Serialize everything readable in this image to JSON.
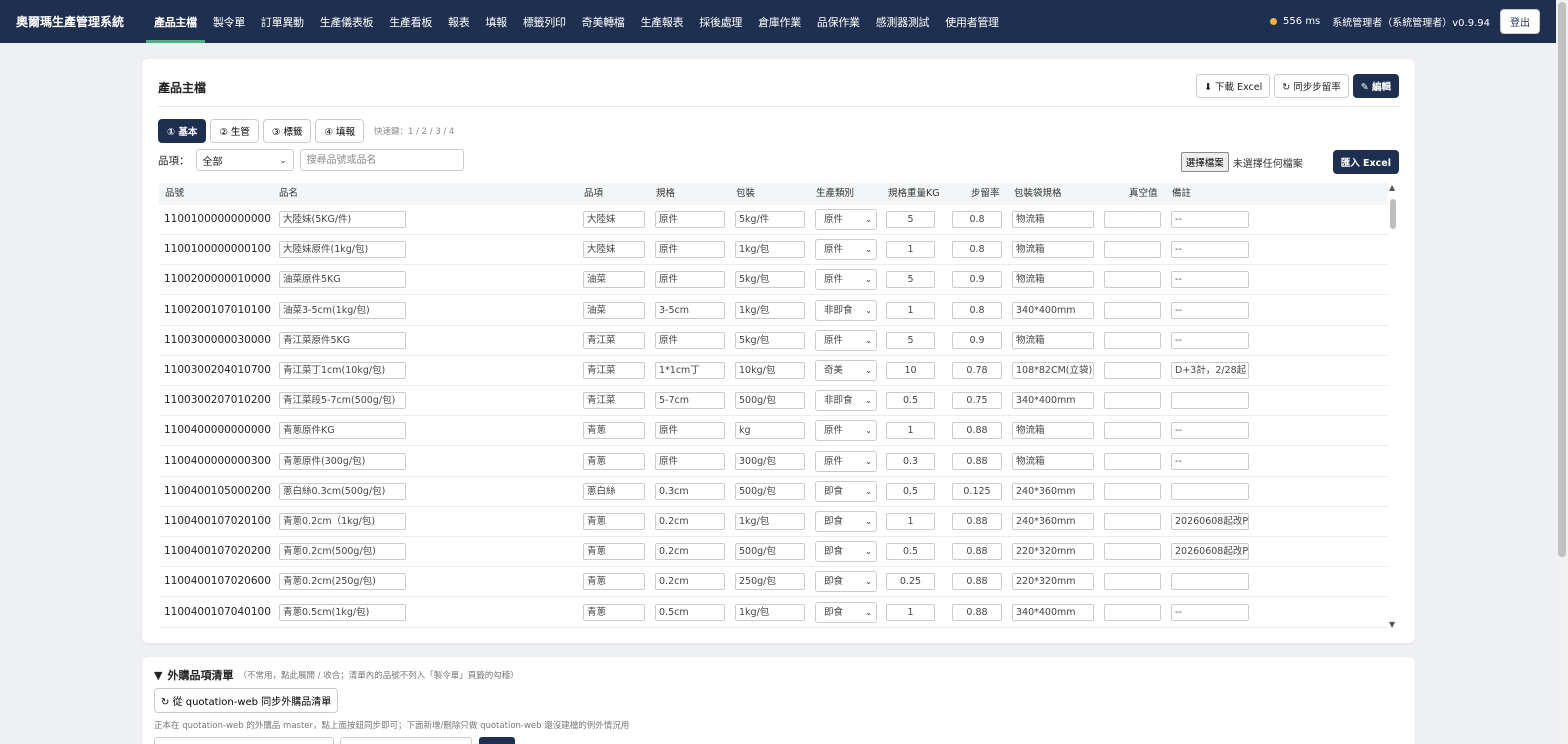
{
  "app": {
    "title": "奧爾瑪生產管理系統",
    "nav": [
      "產品主檔",
      "製令單",
      "訂單異動",
      "生產儀表板",
      "生產看板",
      "報表",
      "填報",
      "標籤列印",
      "奇美轉檔",
      "生產報表",
      "採後處理",
      "倉庫作業",
      "品保作業",
      "感測器測試",
      "使用者管理"
    ],
    "latency": "556 ms",
    "user": "系統管理者（系統管理者）v0.9.94",
    "logout": "登出"
  },
  "page": {
    "title": "產品主檔",
    "download_label": "⬇ 下載 Excel",
    "sync_label": "↻ 同步步留率",
    "edit_label": "✎ 編輯",
    "subtabs": [
      "① 基本",
      "② 生管",
      "③ 標籤",
      "④ 填報"
    ],
    "hint": "快速鍵：1 / 2 / 3 / 4",
    "filter_label": "品項：",
    "filter_value": "全部",
    "search_placeholder": "搜尋品號或品名",
    "choose_file": "選擇檔案",
    "no_file": "未選擇任何檔案",
    "import_label": "匯入 Excel"
  },
  "table": {
    "headers": [
      "品號",
      "品名",
      "品項",
      "規格",
      "包裝",
      "生產類別",
      "規格重量KG",
      "步留率",
      "包裝袋規格",
      "真空值",
      "備註"
    ],
    "rows": [
      {
        "code": "1100100000000000",
        "name": "大陸妹(5KG/件)",
        "item": "大陸妹",
        "spec": "原件",
        "pack": "5kg/件",
        "cat": "原件",
        "kg": "5",
        "yield": "0.8",
        "bag": "物流箱",
        "vac": "",
        "note": "--"
      },
      {
        "code": "1100100000000100",
        "name": "大陸妹原件(1kg/包)",
        "item": "大陸妹",
        "spec": "原件",
        "pack": "1kg/包",
        "cat": "原件",
        "kg": "1",
        "yield": "0.8",
        "bag": "物流箱",
        "vac": "",
        "note": "--"
      },
      {
        "code": "1100200000010000",
        "name": "油菜原件5KG",
        "item": "油菜",
        "spec": "原件",
        "pack": "5kg/包",
        "cat": "原件",
        "kg": "5",
        "yield": "0.9",
        "bag": "物流箱",
        "vac": "",
        "note": "--"
      },
      {
        "code": "1100200107010100",
        "name": "油菜3-5cm(1kg/包)",
        "item": "油菜",
        "spec": "3-5cm",
        "pack": "1kg/包",
        "cat": "非即食",
        "kg": "1",
        "yield": "0.8",
        "bag": "340*400mm",
        "vac": "",
        "note": "--"
      },
      {
        "code": "1100300000030000",
        "name": "青江菜原件5KG",
        "item": "青江菜",
        "spec": "原件",
        "pack": "5kg/包",
        "cat": "原件",
        "kg": "5",
        "yield": "0.9",
        "bag": "物流箱",
        "vac": "",
        "note": "--"
      },
      {
        "code": "1100300204010700",
        "name": "青江菜丁1cm(10kg/包)",
        "item": "青江菜",
        "spec": "1*1cm丁",
        "pack": "10kg/包",
        "cat": "奇美",
        "kg": "10",
        "yield": "0.78",
        "bag": "108*82CM(立袋)",
        "vac": "",
        "note": "D+3計，2/28起"
      },
      {
        "code": "1100300207010200",
        "name": "青江菜段5-7cm(500g/包)",
        "item": "青江菜",
        "spec": "5-7cm",
        "pack": "500g/包",
        "cat": "非即食",
        "kg": "0.5",
        "yield": "0.75",
        "bag": "340*400mm",
        "vac": "",
        "note": ""
      },
      {
        "code": "1100400000000000",
        "name": "青蔥原件KG",
        "item": "青蔥",
        "spec": "原件",
        "pack": "kg",
        "cat": "原件",
        "kg": "1",
        "yield": "0.88",
        "bag": "物流箱",
        "vac": "",
        "note": "--"
      },
      {
        "code": "1100400000000300",
        "name": "青蔥原件(300g/包)",
        "item": "青蔥",
        "spec": "原件",
        "pack": "300g/包",
        "cat": "原件",
        "kg": "0.3",
        "yield": "0.88",
        "bag": "物流箱",
        "vac": "",
        "note": "--"
      },
      {
        "code": "1100400105000200",
        "name": "蔥白絲0.3cm(500g/包)",
        "item": "蔥白絲",
        "spec": "0.3cm",
        "pack": "500g/包",
        "cat": "即食",
        "kg": "0.5",
        "yield": "0.125",
        "bag": "240*360mm",
        "vac": "",
        "note": ""
      },
      {
        "code": "1100400107020100",
        "name": "青蔥0.2cm（1kg/包)",
        "item": "青蔥",
        "spec": "0.2cm",
        "pack": "1kg/包",
        "cat": "即食",
        "kg": "1",
        "yield": "0.88",
        "bag": "240*360mm",
        "vac": "",
        "note": "20260608起改P"
      },
      {
        "code": "1100400107020200",
        "name": "青蔥0.2cm(500g/包)",
        "item": "青蔥",
        "spec": "0.2cm",
        "pack": "500g/包",
        "cat": "即食",
        "kg": "0.5",
        "yield": "0.88",
        "bag": "220*320mm",
        "vac": "",
        "note": "20260608起改P"
      },
      {
        "code": "1100400107020600",
        "name": "青蔥0.2cm(250g/包)",
        "item": "青蔥",
        "spec": "0.2cm",
        "pack": "250g/包",
        "cat": "即食",
        "kg": "0.25",
        "yield": "0.88",
        "bag": "220*320mm",
        "vac": "",
        "note": ""
      },
      {
        "code": "1100400107040100",
        "name": "青蔥0.5cm(1kg/包)",
        "item": "青蔥",
        "spec": "0.5cm",
        "pack": "1kg/包",
        "cat": "即食",
        "kg": "1",
        "yield": "0.88",
        "bag": "340*400mm",
        "vac": "",
        "note": "--"
      }
    ]
  },
  "external": {
    "toggle": "▼",
    "title": "外購品項清單",
    "note": "（不常用，點此展開 / 收合；清單內的品號不列入「製令單」頁籤的勾稽）",
    "sync_label": "↻ 從 quotation-web 同步外購品清單",
    "desc": "正本在 quotation-web 的外購品 master，點上面按鈕同步即可；下面新增/刪除只做 quotation-web 還沒建檔的例外情況用"
  },
  "colors": {
    "nav_bg": "#1e2f4f",
    "accent": "#4caf82",
    "status_dot": "#f3b33d"
  }
}
